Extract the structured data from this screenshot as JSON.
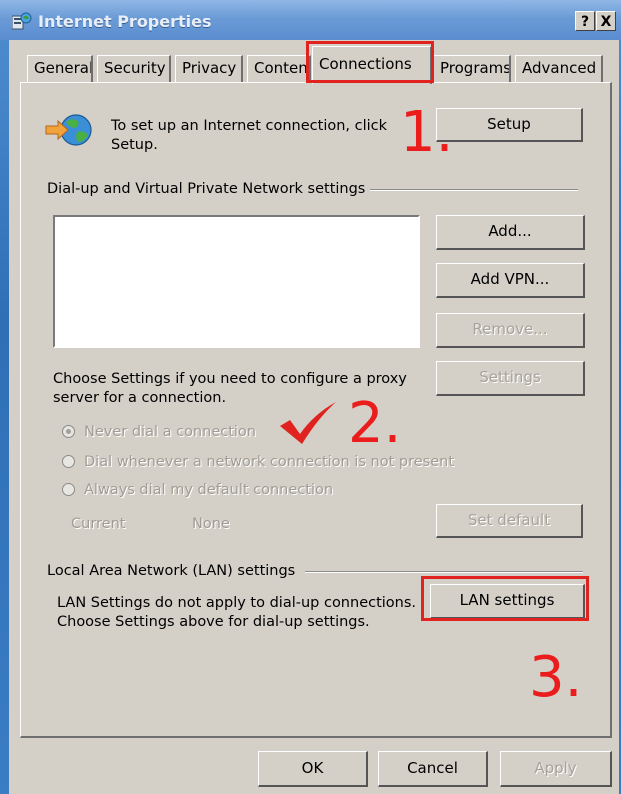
{
  "window": {
    "title": "Internet Properties",
    "help_button": "?",
    "close_button": "X"
  },
  "tabs": [
    {
      "label": "General"
    },
    {
      "label": "Security"
    },
    {
      "label": "Privacy"
    },
    {
      "label": "Content"
    },
    {
      "label": "Connections",
      "active": true
    },
    {
      "label": "Programs"
    },
    {
      "label": "Advanced"
    }
  ],
  "setup": {
    "text_line1": "To set up an Internet connection, click",
    "text_line2": "Setup.",
    "button": "Setup"
  },
  "dialup": {
    "group_label": "Dial-up and Virtual Private Network settings",
    "add_button": "Add...",
    "add_vpn_button": "Add VPN...",
    "remove_button": "Remove...",
    "settings_button": "Settings",
    "proxy_line1": "Choose Settings if you need to configure a proxy",
    "proxy_line2": "server for a connection.",
    "radio_never": "Never dial a connection",
    "radio_whenever": "Dial whenever a network connection is not present",
    "radio_always": "Always dial my default connection",
    "current_label": "Current",
    "current_value": "None",
    "set_default_button": "Set default"
  },
  "lan": {
    "group_label": "Local Area Network (LAN) settings",
    "text_line1": "LAN Settings do not apply to dial-up connections.",
    "text_line2": "Choose Settings above for dial-up settings.",
    "button": "LAN settings"
  },
  "footer": {
    "ok": "OK",
    "cancel": "Cancel",
    "apply": "Apply"
  },
  "annotations": {
    "step1": "1.",
    "step2": "2.",
    "step3": "3.",
    "color": "#e0231f"
  }
}
